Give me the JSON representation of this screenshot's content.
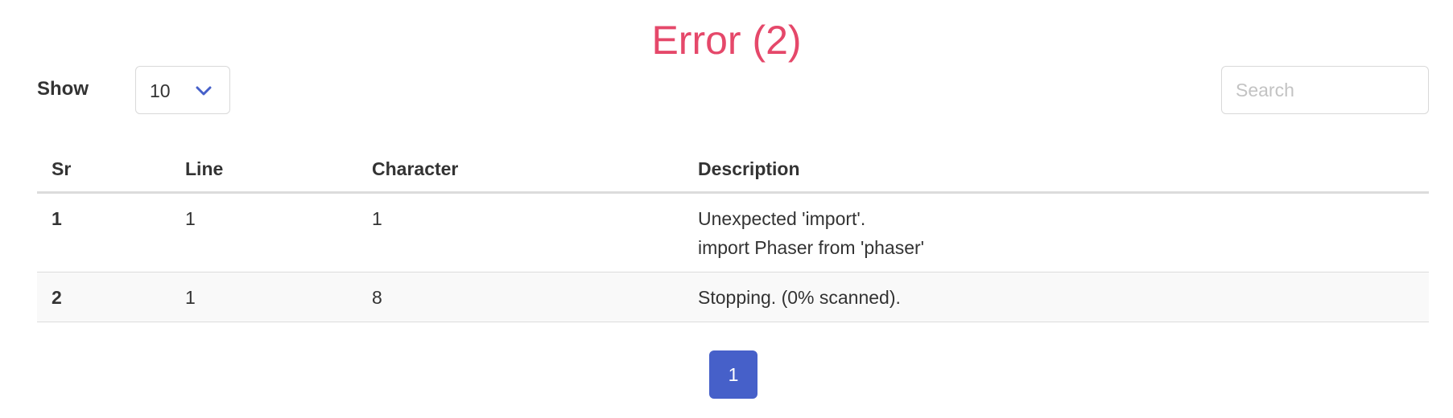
{
  "title": "Error (2)",
  "controls": {
    "show_label": "Show",
    "page_size": "10",
    "search_placeholder": "Search"
  },
  "table": {
    "headers": [
      "Sr",
      "Line",
      "Character",
      "Description"
    ],
    "rows": [
      {
        "sr": "1",
        "line": "1",
        "character": "1",
        "description": [
          "Unexpected 'import'.",
          "import Phaser from 'phaser'"
        ]
      },
      {
        "sr": "2",
        "line": "1",
        "character": "8",
        "description": [
          "Stopping. (0% scanned)."
        ]
      }
    ]
  },
  "pagination": {
    "current": "1"
  },
  "colors": {
    "title": "#e5486a",
    "accent": "#4660c9"
  },
  "icons": {
    "select_caret": "chevron-down-icon"
  }
}
